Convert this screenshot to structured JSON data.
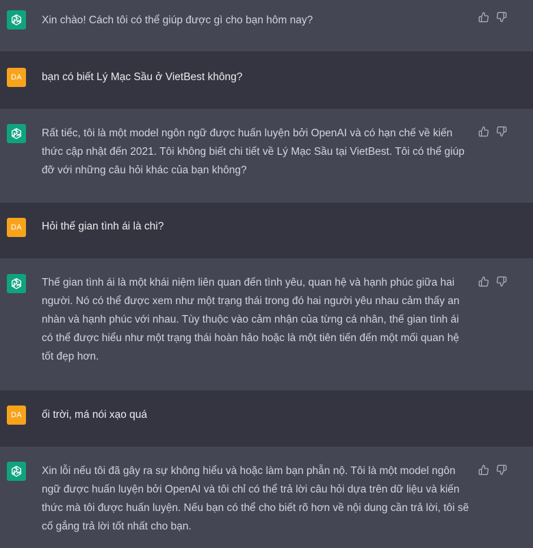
{
  "user": {
    "initials": "DA"
  },
  "icons": {
    "assistant_avatar": "openai-logo-icon",
    "thumbs_up": "thumbs-up-icon",
    "thumbs_down": "thumbs-down-icon"
  },
  "colors": {
    "assistant_bg": "#444654",
    "user_bg": "#343541",
    "assistant_avatar": "#10a37f",
    "user_avatar": "#f7a31c",
    "text": "#d1d5db"
  },
  "messages": [
    {
      "role": "assistant",
      "text": "Xin chào! Cách tôi có thể giúp được gì cho bạn hôm nay?"
    },
    {
      "role": "user",
      "text": "bạn có biết Lý Mạc Sầu ở VietBest không?"
    },
    {
      "role": "assistant",
      "text": "Rất tiếc, tôi là một model ngôn ngữ được huấn luyện bởi OpenAI và có hạn chế về kiến thức cập nhật đến 2021. Tôi không biết chi tiết về Lý Mạc Sầu tại VietBest. Tôi có thể giúp đỡ với những câu hỏi khác của bạn không?"
    },
    {
      "role": "user",
      "text": "Hỏi thế gian tình ái là chi?"
    },
    {
      "role": "assistant",
      "text": "Thế gian tình ái là một khái niệm liên quan đến tình yêu, quan hệ và hạnh phúc giữa hai người. Nó có thể được xem như một trạng thái trong đó hai người yêu nhau cảm thấy an nhàn và hạnh phúc với nhau. Tùy thuộc vào cảm nhận của từng cá nhân, thế gian tình ái có thể được hiểu như một trạng thái hoàn hảo hoặc là một tiên tiến đến một mối quan hệ tốt đẹp hơn."
    },
    {
      "role": "user",
      "text": "ối trời, má nói xạo quá"
    },
    {
      "role": "assistant",
      "text": "Xin lỗi nếu tôi đã gây ra sự không hiểu và hoặc làm bạn phẫn nộ. Tôi là một model ngôn ngữ được huấn luyện bởi OpenAI và tôi chỉ có thể trả lời câu hỏi dựa trên dữ liệu và kiến thức mà tôi được huấn luyện. Nếu bạn có thể cho biết rõ hơn về nội dung cần trả lời, tôi sẽ cố gắng trả lời tốt nhất cho bạn."
    }
  ]
}
